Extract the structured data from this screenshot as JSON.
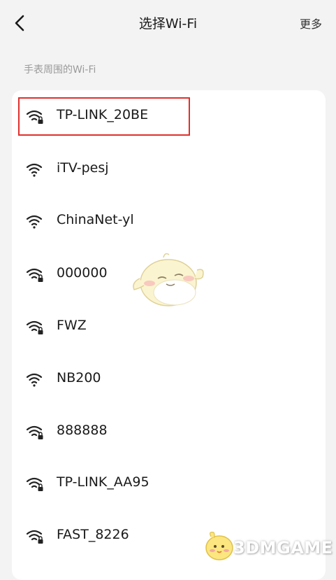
{
  "header": {
    "title": "选择Wi-Fi",
    "more_label": "更多"
  },
  "section_label": "手表周围的Wi-Fi",
  "networks": [
    {
      "ssid": "TP-LINK_20BE",
      "secured": true,
      "highlighted": true
    },
    {
      "ssid": "iTV-pesj",
      "secured": false
    },
    {
      "ssid": "ChinaNet-yl",
      "secured": false
    },
    {
      "ssid": "000000",
      "secured": true
    },
    {
      "ssid": "FWZ",
      "secured": true
    },
    {
      "ssid": "NB200",
      "secured": false
    },
    {
      "ssid": "888888",
      "secured": true
    },
    {
      "ssid": "TP-LINK_AA95",
      "secured": true
    },
    {
      "ssid": "FAST_8226",
      "secured": true
    }
  ],
  "watermark": "3DMGAME",
  "colors": {
    "highlight_border": "#e0302c",
    "page_background": "#f3f3f3",
    "card_background": "#ffffff",
    "secondary_text": "#9a9a9a"
  }
}
